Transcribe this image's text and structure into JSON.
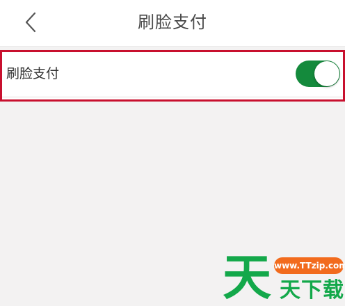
{
  "navbar": {
    "back_icon": "chevron-left-icon",
    "title": "刷脸支付"
  },
  "settings": {
    "face_pay": {
      "label": "刷脸支付",
      "enabled": true
    }
  },
  "highlight_color": "#c8102e",
  "toggle_on_color": "#148a3c",
  "watermark": {
    "big_char": "天",
    "url": "www.TTzip.com",
    "text": "天下载"
  }
}
